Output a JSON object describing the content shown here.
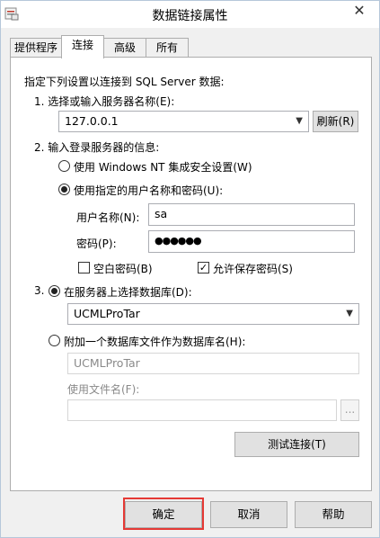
{
  "window": {
    "title": "数据链接属性",
    "close_glyph": "✕"
  },
  "tabs": [
    {
      "label": "提供程序",
      "active": false
    },
    {
      "label": "连接",
      "active": true
    },
    {
      "label": "高级",
      "active": false
    },
    {
      "label": "所有",
      "active": false
    }
  ],
  "connection": {
    "intro": "指定下列设置以连接到 SQL Server 数据:",
    "step1_label": "1. 选择或输入服务器名称(E):",
    "server_name": "127.0.0.1",
    "refresh_label": "刷新(R)",
    "step2_label": "2. 输入登录服务器的信息:",
    "windows_auth_label": "使用 Windows NT 集成安全设置(W)",
    "windows_auth_selected": false,
    "sql_auth_label": "使用指定的用户名称和密码(U):",
    "sql_auth_selected": true,
    "username_label": "用户名称(N):",
    "username_value": "sa",
    "password_label": "密码(P):",
    "password_value": "●●●●●●",
    "blank_password_label": "空白密码(B)",
    "blank_password_checked": false,
    "allow_save_password_label": "允许保存密码(S)",
    "allow_save_password_checked": true,
    "step3_number": "3.",
    "select_db_label": "在服务器上选择数据库(D):",
    "select_db_selected": true,
    "database_name": "UCMLProTar",
    "attach_db_label": "附加一个数据库文件作为数据库名(H):",
    "attach_db_selected": false,
    "attach_db_name": "UCMLProTar",
    "use_filename_label": "使用文件名(F):",
    "use_filename_value": "",
    "browse_label": "...",
    "test_connection_label": "测试连接(T)"
  },
  "footer": {
    "ok_label": "确定",
    "cancel_label": "取消",
    "help_label": "帮助"
  },
  "colors": {
    "highlight": "#e53935"
  }
}
